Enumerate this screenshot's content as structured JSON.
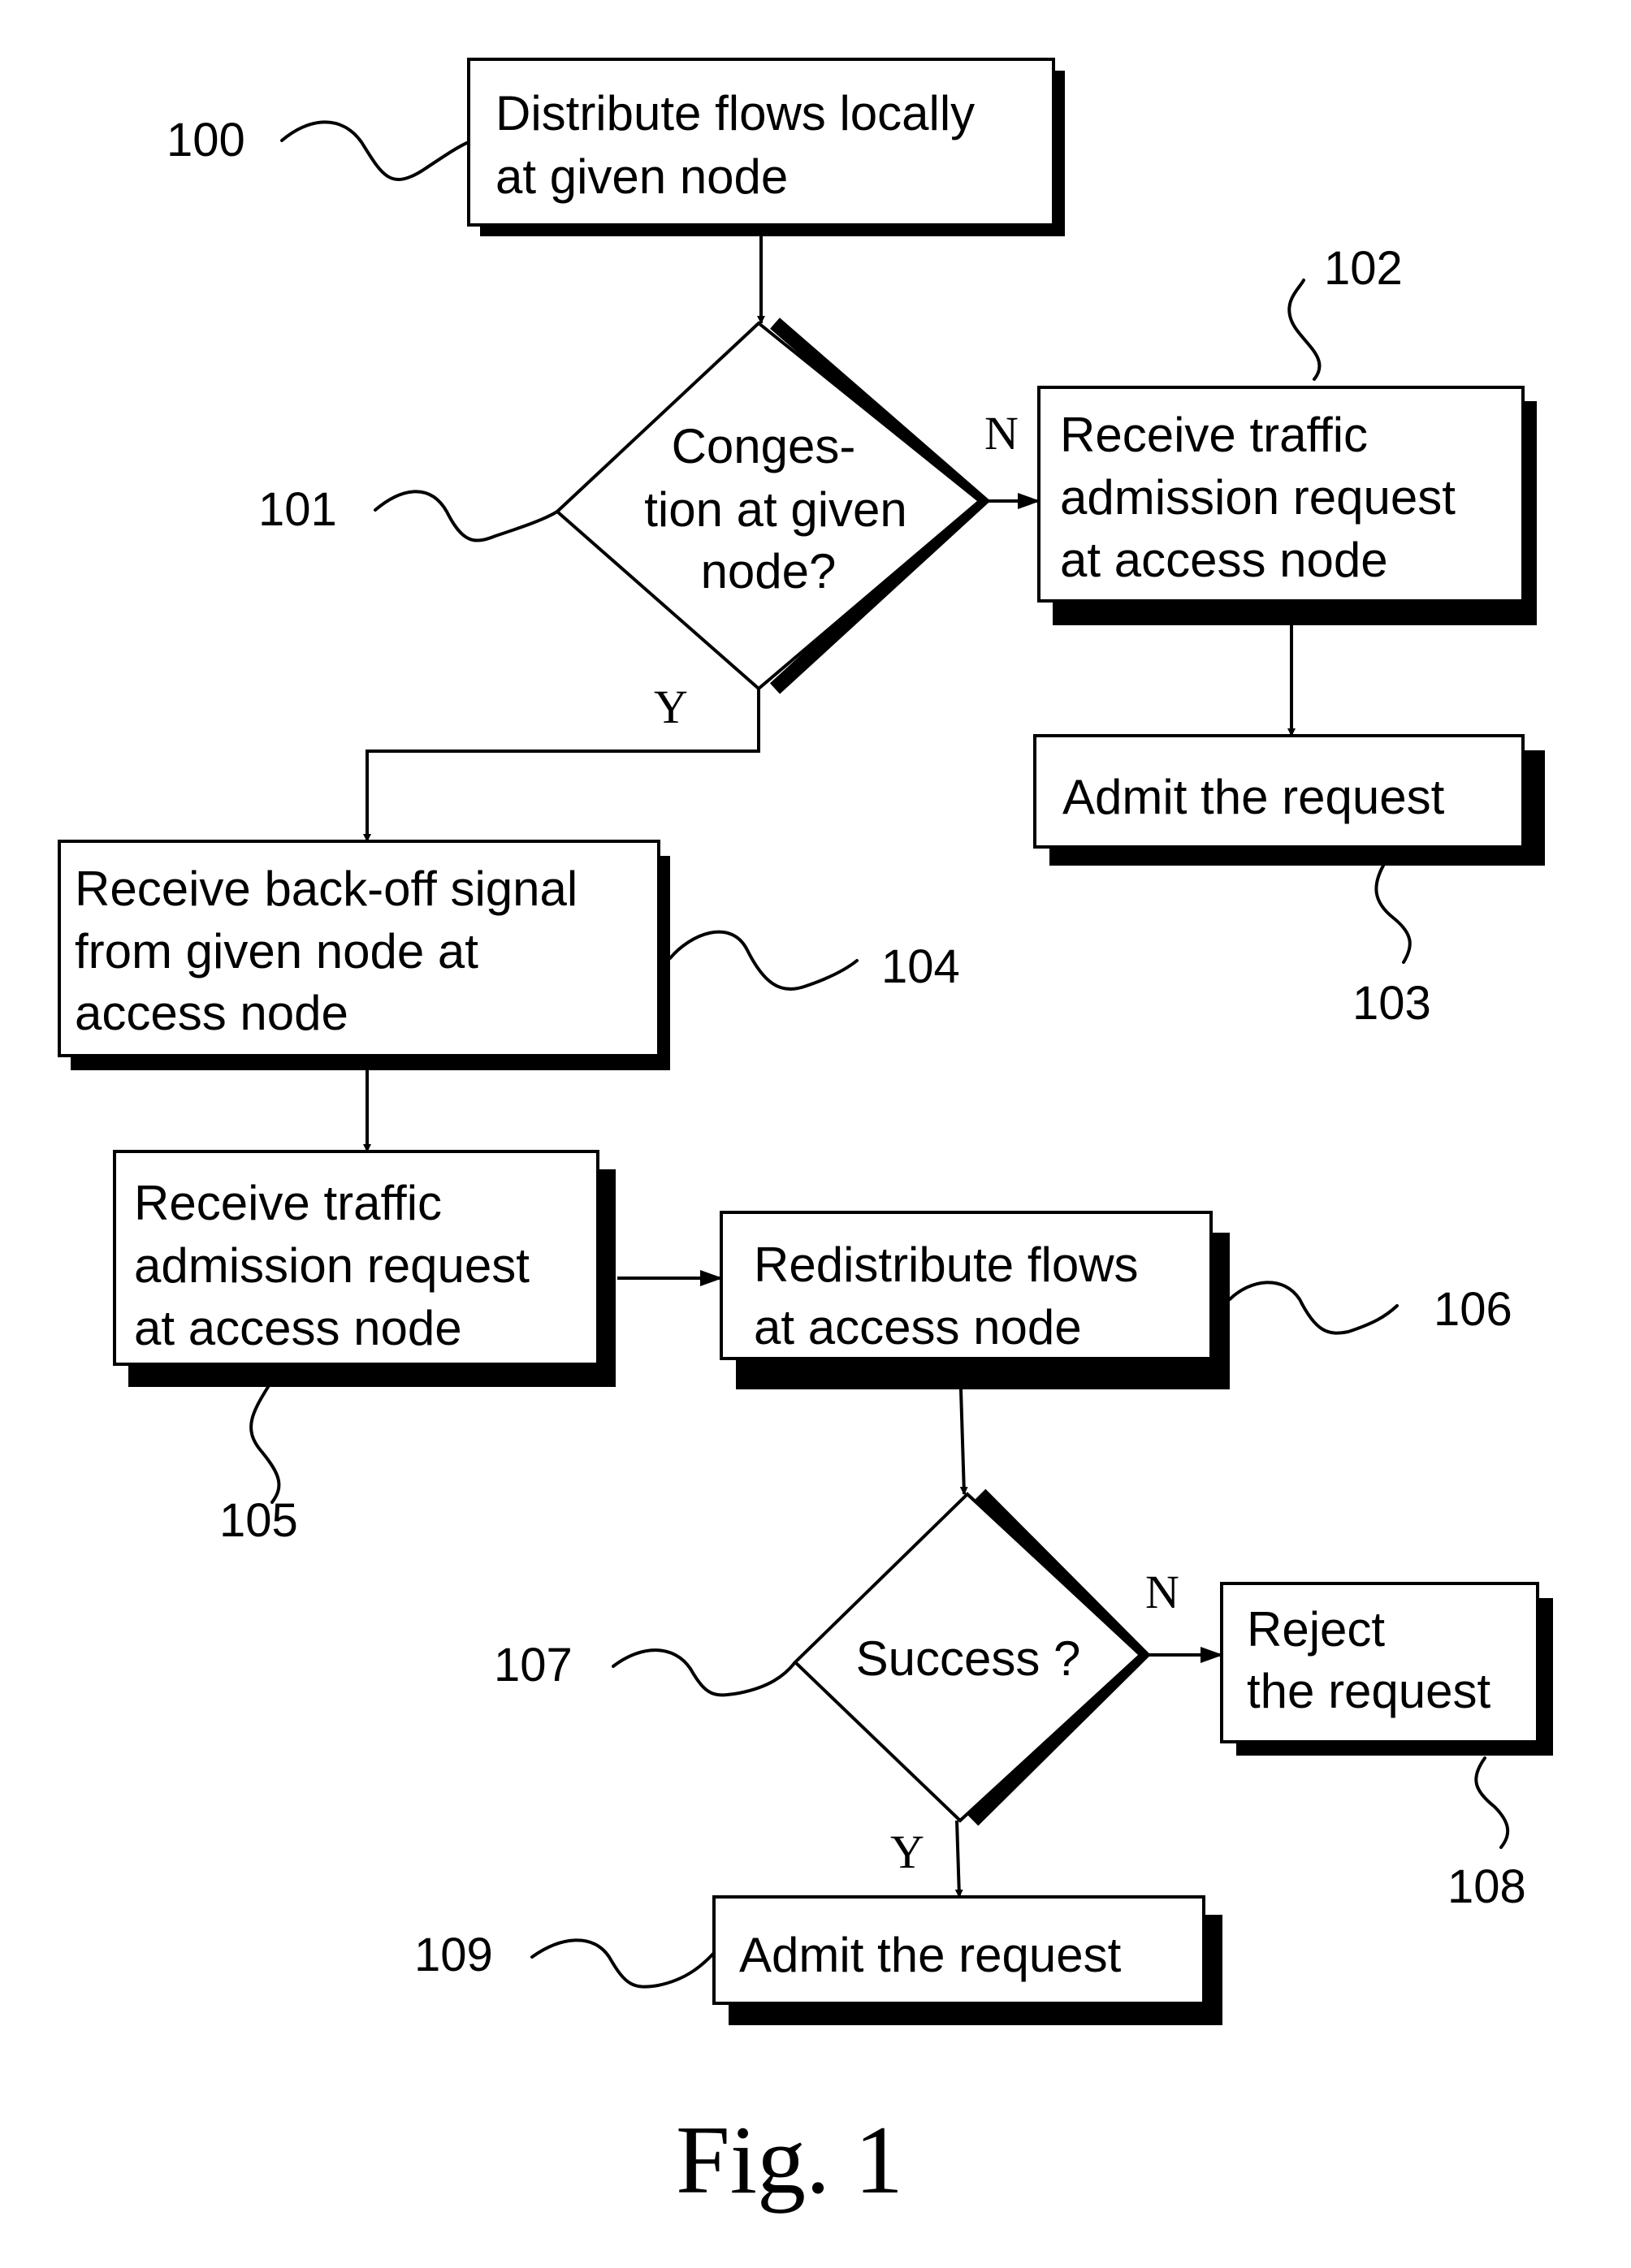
{
  "figure": {
    "caption": "Fig. 1",
    "nodes": [
      {
        "id": "100",
        "type": "process",
        "lines": [
          "Distribute flows locally",
          "at given node"
        ]
      },
      {
        "id": "101",
        "type": "decision",
        "lines": [
          "Conges-",
          "tion at given",
          "node?"
        ]
      },
      {
        "id": "102",
        "type": "process",
        "lines": [
          "Receive traffic",
          "admission request",
          "at access node"
        ]
      },
      {
        "id": "103",
        "type": "process",
        "lines": [
          "Admit the request"
        ]
      },
      {
        "id": "104",
        "type": "process",
        "lines": [
          "Receive back-off signal",
          "from given node at",
          "access node"
        ]
      },
      {
        "id": "105",
        "type": "process",
        "lines": [
          "Receive traffic",
          "admission request",
          "at access node"
        ]
      },
      {
        "id": "106",
        "type": "process",
        "lines": [
          "Redistribute flows",
          "at access node"
        ]
      },
      {
        "id": "107",
        "type": "decision",
        "lines": [
          "Success ?"
        ]
      },
      {
        "id": "108",
        "type": "process",
        "lines": [
          "Reject",
          "the request"
        ]
      },
      {
        "id": "109",
        "type": "process",
        "lines": [
          "Admit the request"
        ]
      }
    ],
    "edges": [
      {
        "from": "100",
        "to": "101",
        "label": ""
      },
      {
        "from": "101",
        "to": "102",
        "label": "N"
      },
      {
        "from": "101",
        "to": "104",
        "label": "Y"
      },
      {
        "from": "102",
        "to": "103",
        "label": ""
      },
      {
        "from": "104",
        "to": "105",
        "label": ""
      },
      {
        "from": "105",
        "to": "106",
        "label": ""
      },
      {
        "from": "106",
        "to": "107",
        "label": ""
      },
      {
        "from": "107",
        "to": "108",
        "label": "N"
      },
      {
        "from": "107",
        "to": "109",
        "label": "Y"
      }
    ],
    "reference_labels": [
      "100",
      "101",
      "102",
      "103",
      "104",
      "105",
      "106",
      "107",
      "108",
      "109"
    ]
  }
}
